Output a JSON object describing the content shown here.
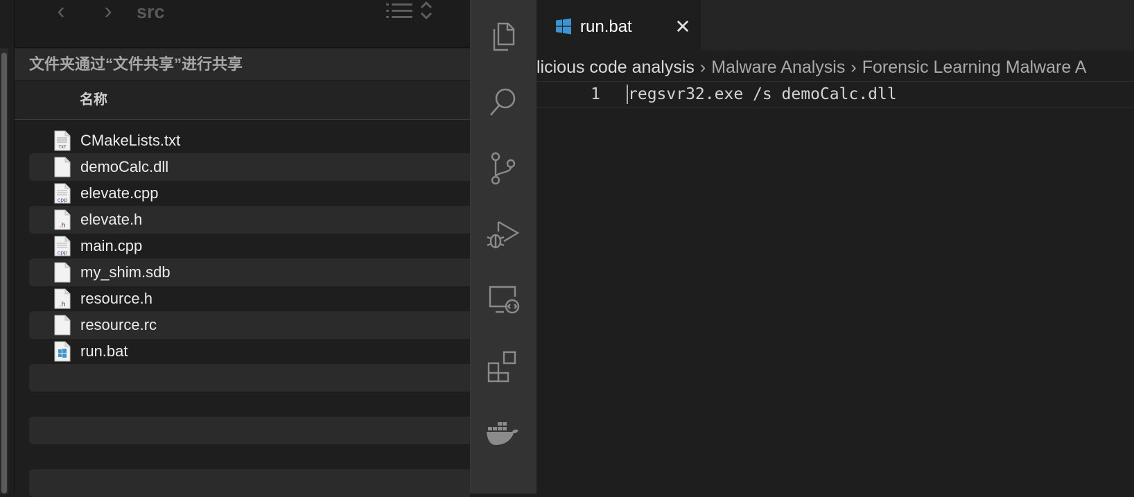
{
  "finder": {
    "folder_title": "src",
    "share_notice": "文件夹通过“文件共享”进行共享",
    "column_name": "名称",
    "files": [
      {
        "name": "CMakeLists.txt",
        "icon": "txt-file-icon",
        "badge": "TXT"
      },
      {
        "name": "demoCalc.dll",
        "icon": "blank-file-icon",
        "badge": ""
      },
      {
        "name": "elevate.cpp",
        "icon": "cpp-file-icon",
        "badge": "cpp"
      },
      {
        "name": "elevate.h",
        "icon": "h-file-icon",
        "badge": ".h"
      },
      {
        "name": "main.cpp",
        "icon": "cpp-file-icon",
        "badge": "cpp"
      },
      {
        "name": "my_shim.sdb",
        "icon": "blank-file-icon",
        "badge": ""
      },
      {
        "name": "resource.h",
        "icon": "h-file-icon",
        "badge": ".h"
      },
      {
        "name": "resource.rc",
        "icon": "blank-file-icon",
        "badge": ""
      },
      {
        "name": "run.bat",
        "icon": "windows-file-icon",
        "badge": ""
      }
    ]
  },
  "vscode": {
    "tab": {
      "label": "run.bat",
      "close": "✕"
    },
    "breadcrumbs": [
      "licious code analysis",
      "Malware Analysis",
      "Forensic Learning Malware A"
    ],
    "lines": [
      {
        "number": "1",
        "text": "regsvr32.exe /s demoCalc.dll"
      }
    ],
    "activity_icons": [
      "explorer-icon",
      "search-icon",
      "source-control-icon",
      "run-debug-icon",
      "remote-explorer-icon",
      "extensions-icon",
      "docker-icon"
    ]
  },
  "colors": {
    "windows_blue": "#3a95d0",
    "h_badge": "#7a3b3b",
    "cpp_badge": "#5b4a8a"
  }
}
